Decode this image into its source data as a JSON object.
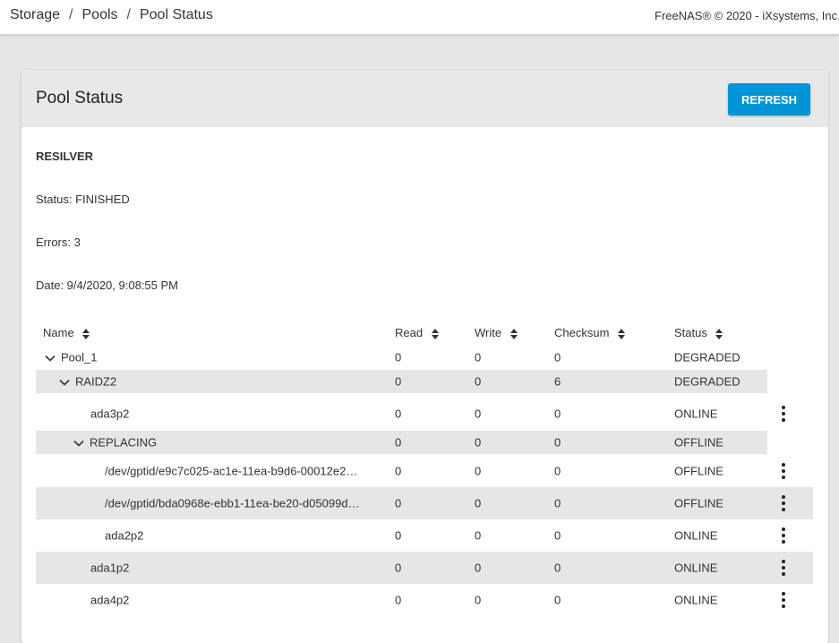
{
  "breadcrumb": [
    {
      "label": "Storage"
    },
    {
      "label": "Pools"
    },
    {
      "label": "Pool Status"
    }
  ],
  "copyright": "FreeNAS® © 2020 - iXsystems, Inc.",
  "card": {
    "title": "Pool Status",
    "refresh_label": "REFRESH"
  },
  "scan": {
    "heading": "RESILVER",
    "status": "Status: FINISHED",
    "errors": "Errors: 3",
    "date": "Date: 9/4/2020, 9:08:55 PM"
  },
  "table": {
    "columns": {
      "name": "Name",
      "read": "Read",
      "write": "Write",
      "checksum": "Checksum",
      "status": "Status"
    },
    "rows": [
      {
        "name": "Pool_1",
        "read": "0",
        "write": "0",
        "checksum": "0",
        "status": "DEGRADED"
      },
      {
        "name": "RAIDZ2",
        "read": "0",
        "write": "0",
        "checksum": "6",
        "status": "DEGRADED"
      },
      {
        "name": "ada3p2",
        "read": "0",
        "write": "0",
        "checksum": "0",
        "status": "ONLINE"
      },
      {
        "name": "REPLACING",
        "read": "0",
        "write": "0",
        "checksum": "0",
        "status": "OFFLINE"
      },
      {
        "name": "/dev/gptid/e9c7c025-ac1e-11ea-b9d6-00012e2…",
        "read": "0",
        "write": "0",
        "checksum": "0",
        "status": "OFFLINE"
      },
      {
        "name": "/dev/gptid/bda0968e-ebb1-11ea-be20-d05099d…",
        "read": "0",
        "write": "0",
        "checksum": "0",
        "status": "OFFLINE"
      },
      {
        "name": "ada2p2",
        "read": "0",
        "write": "0",
        "checksum": "0",
        "status": "ONLINE"
      },
      {
        "name": "ada1p2",
        "read": "0",
        "write": "0",
        "checksum": "0",
        "status": "ONLINE"
      },
      {
        "name": "ada4p2",
        "read": "0",
        "write": "0",
        "checksum": "0",
        "status": "ONLINE"
      }
    ]
  },
  "icons": {
    "sort": "sort-icon",
    "expand": "chevron-down-icon",
    "actions": "more-vert-icon"
  }
}
